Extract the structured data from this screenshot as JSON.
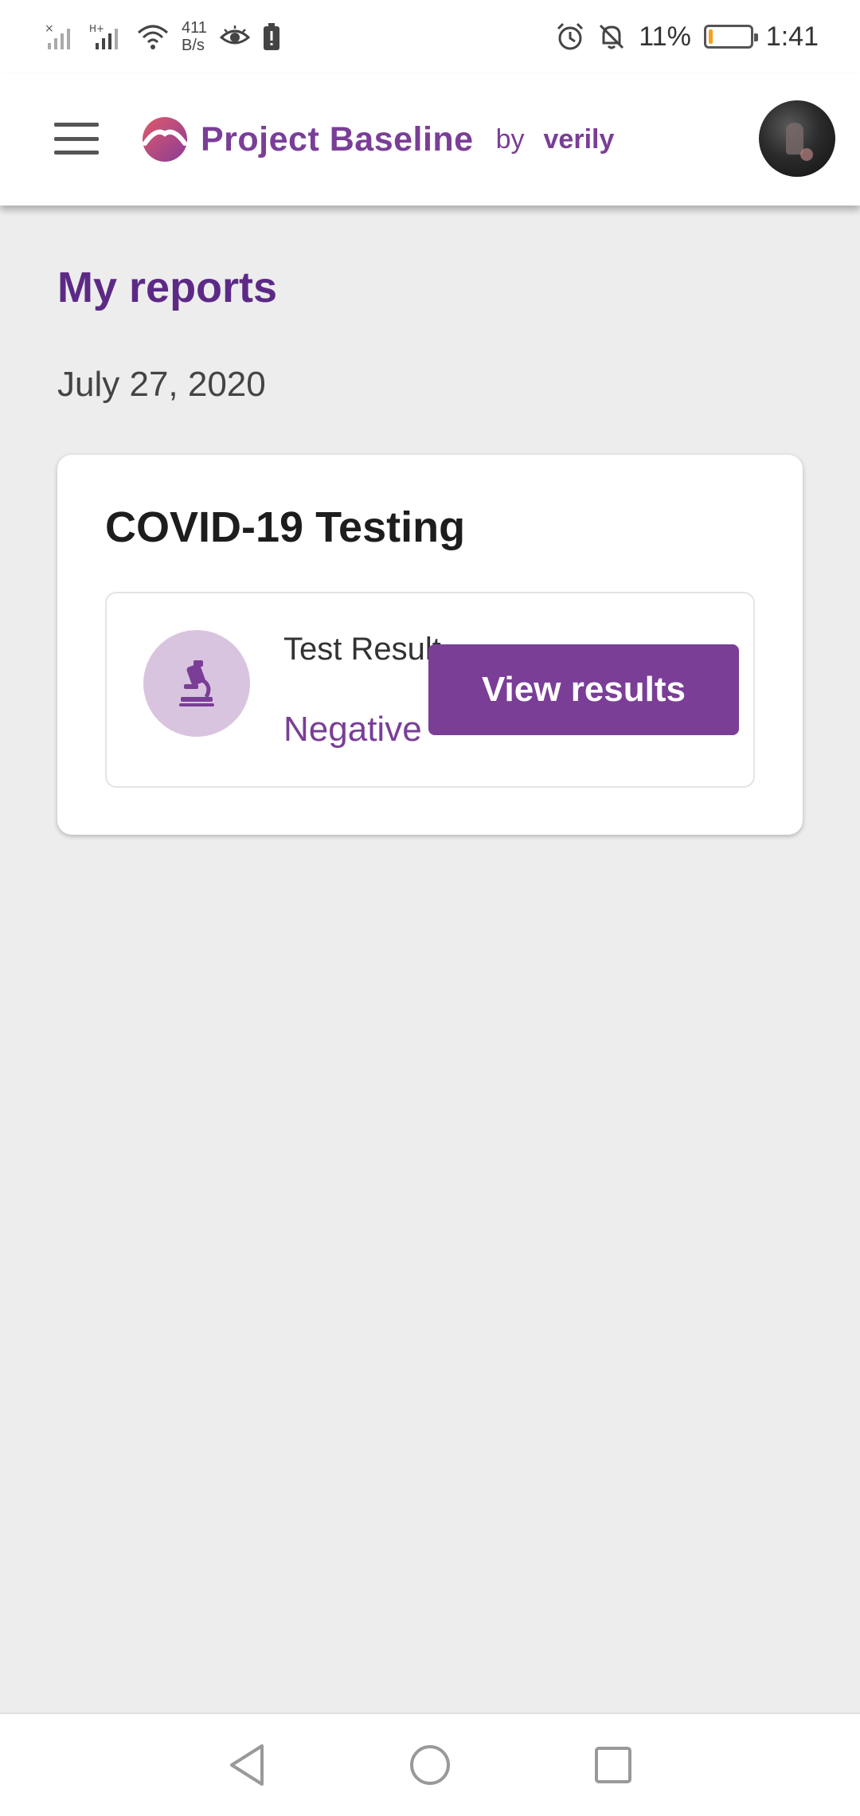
{
  "status_bar": {
    "net_speed_value": "411",
    "net_speed_unit": "B/s",
    "battery_percent": "11%",
    "time": "1:41",
    "battery_level": 0.11,
    "battery_color": "#f5a21a",
    "icons": [
      "signal-no-sim-icon",
      "signal-hplus-icon",
      "wifi-icon",
      "eye-comfort-icon",
      "battery-alert-icon",
      "alarm-icon",
      "mute-bell-icon"
    ]
  },
  "app_bar": {
    "brand_name": "Project Baseline",
    "brand_by": "by",
    "brand_company": "verily",
    "brand_color": "#7a3e97",
    "menu_icon": "hamburger-menu-icon",
    "avatar_icon": "user-avatar"
  },
  "main": {
    "page_title": "My reports",
    "report_date": "July 27, 2020",
    "card": {
      "title": "COVID-19 Testing",
      "result_icon": "microscope-icon",
      "result_label": "Test Result",
      "result_value": "Negative",
      "button_label": "View results"
    }
  },
  "nav_bar": {
    "buttons": [
      "back-icon",
      "home-icon",
      "recents-icon"
    ]
  }
}
